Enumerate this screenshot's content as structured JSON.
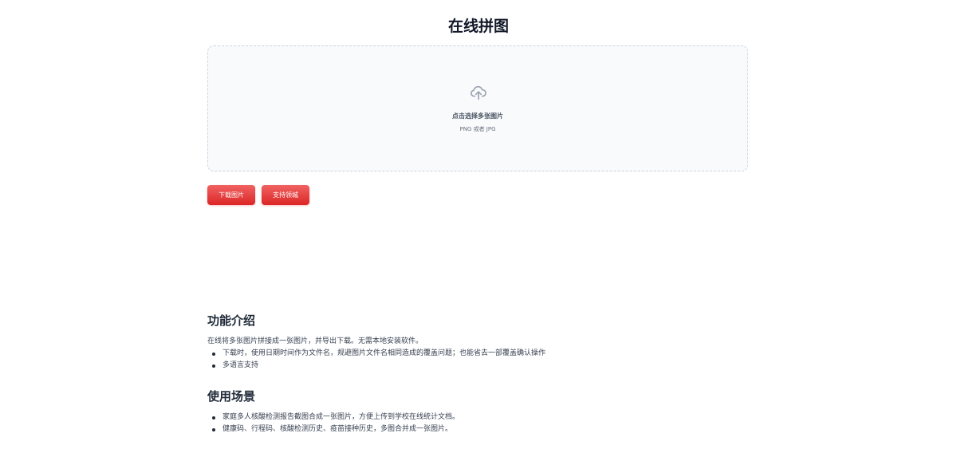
{
  "page": {
    "title": "在线拼图"
  },
  "upload": {
    "icon": "cloud-upload-icon",
    "label": "点击选择多张图片",
    "hint": "PNG 或者 JPG"
  },
  "actions": {
    "download_label": "下载图片",
    "support_label": "支持领城"
  },
  "features": {
    "title": "功能介绍",
    "intro": "在线将多张图片拼接成一张图片，并导出下载。无需本地安装软件。",
    "items": [
      "下载时，使用日期时间作为文件名，规避图片文件名相同造成的覆盖问题；也能省去一部覆盖确认操作",
      "多语言支持"
    ]
  },
  "usecases": {
    "title": "使用场景",
    "items": [
      "家庭多人核酸检测报告截图合成一张图片，方便上传到学校在线统计文档。",
      "健康码、行程码、核酸检测历史、疫苗接种历史，多图合并成一张图片。"
    ]
  },
  "colors": {
    "accent": "#dc2626",
    "accent_light": "#f06262",
    "dropzone_bg": "#f8fafc",
    "dropzone_border": "#cbd5e1"
  }
}
